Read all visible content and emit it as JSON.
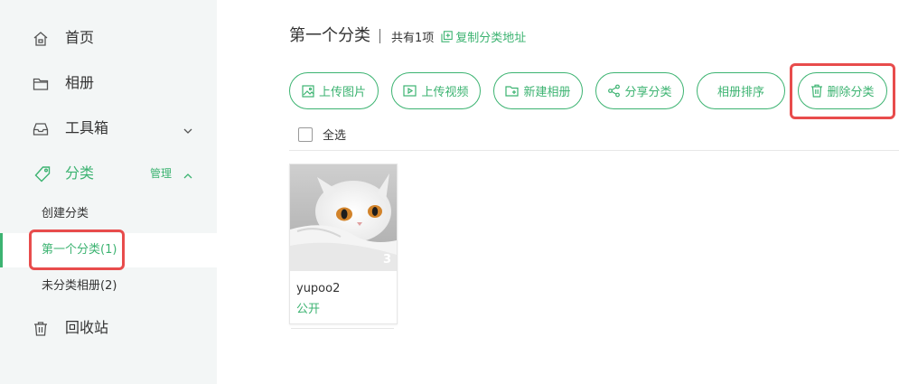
{
  "sidebar": {
    "home": "首页",
    "albums": "相册",
    "toolbox": "工具箱",
    "category": "分类",
    "manage": "管理",
    "create_category": "创建分类",
    "current_category": "第一个分类(1)",
    "uncategorized": "未分类相册(2)",
    "recycle": "回收站"
  },
  "main": {
    "title": "第一个分类",
    "count_text": "共有1项",
    "copy_link": "复制分类地址",
    "toolbar": {
      "upload_image": "上传图片",
      "upload_video": "上传视频",
      "new_album": "新建相册",
      "share_category": "分享分类",
      "sort_albums": "相册排序",
      "delete_category": "删除分类"
    },
    "select_all": "全选",
    "albums": [
      {
        "name": "yupoo2",
        "visibility": "公开",
        "photo_count": "3"
      }
    ]
  },
  "colors": {
    "accent": "#3cb371",
    "highlight": "#e84c4c",
    "sidebar_bg": "#f3f6f6"
  }
}
